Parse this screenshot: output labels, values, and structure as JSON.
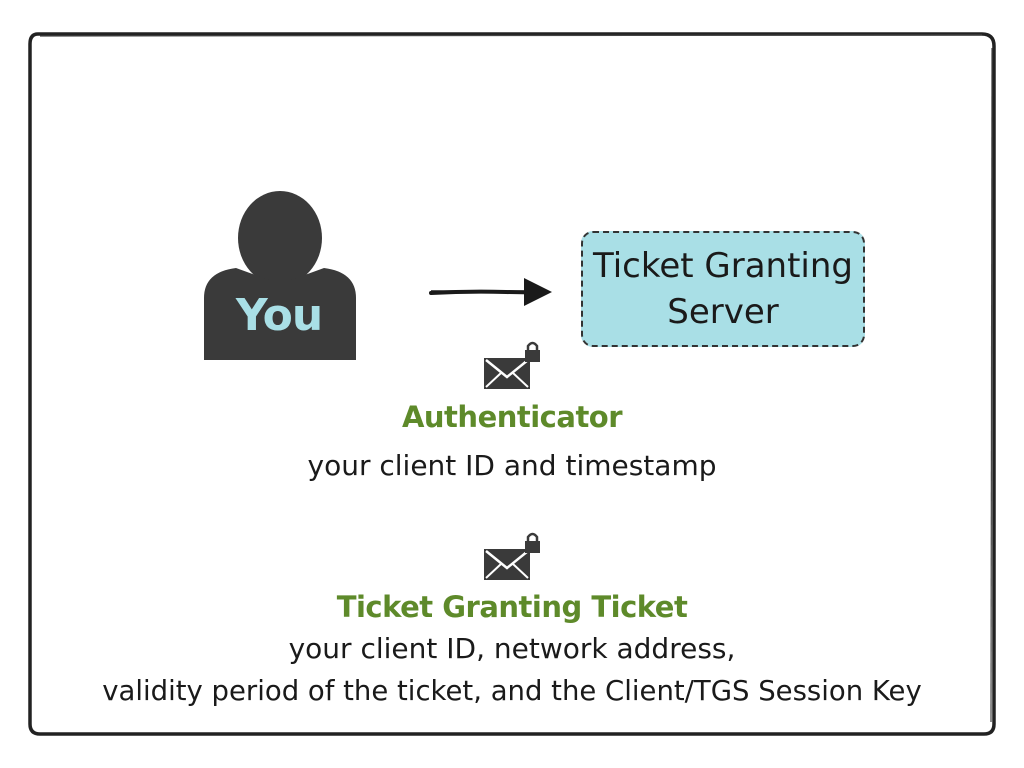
{
  "colors": {
    "frame": "#222222",
    "server_fill": "#a9dfe6",
    "person": "#3a3a3a",
    "you_text": "#a9dfe6",
    "heading_green": "#5e8a2a",
    "body_text": "#1a1a1a"
  },
  "client": {
    "label": "You"
  },
  "server": {
    "line1": "Ticket Granting",
    "line2": "Server"
  },
  "authenticator": {
    "icon": "locked-envelope-icon",
    "title": "Authenticator",
    "description": "your client ID and timestamp"
  },
  "ticket_granting_ticket": {
    "icon": "locked-envelope-icon",
    "title": "Ticket Granting Ticket",
    "description_line1": "your client ID, network address,",
    "description_line2": "validity period of the ticket, and the Client/TGS Session Key"
  }
}
